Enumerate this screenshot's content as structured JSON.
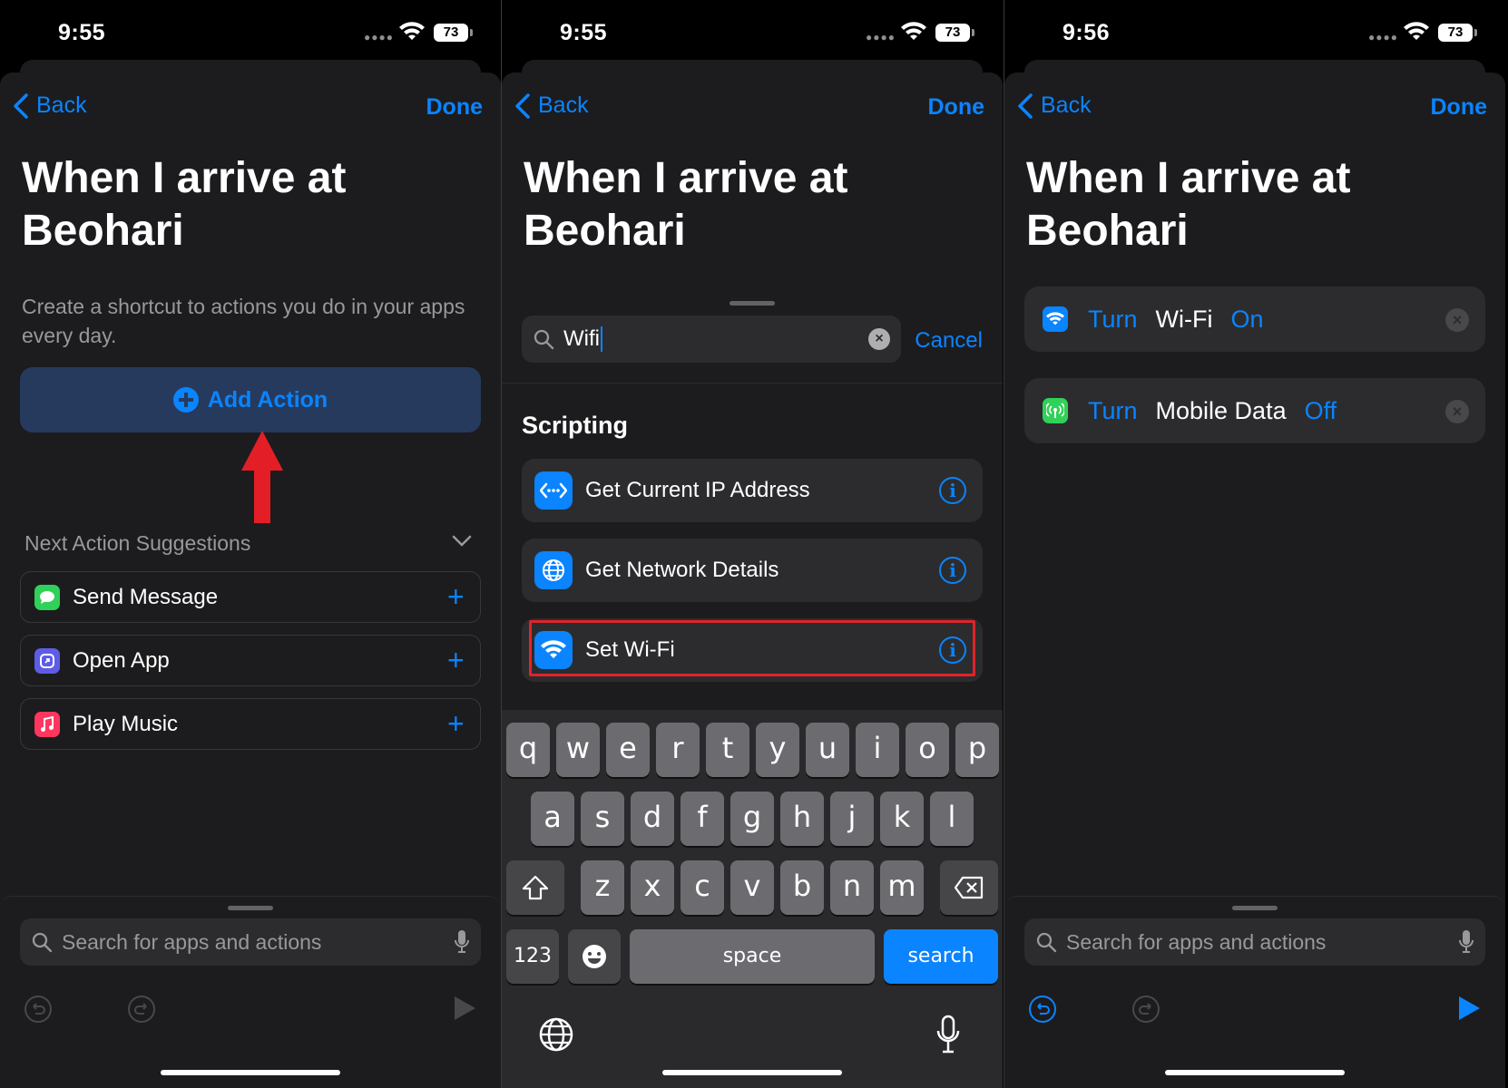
{
  "status_bars": [
    {
      "time": "9:55",
      "battery": "73"
    },
    {
      "time": "9:55",
      "battery": "73"
    },
    {
      "time": "9:56",
      "battery": "73"
    }
  ],
  "nav": {
    "back_label": "Back",
    "done_label": "Done"
  },
  "automation_title": "When I arrive at Beohari",
  "panel1": {
    "description": "Create a shortcut to actions you do in your apps every day.",
    "add_action_label": "Add Action",
    "suggestions_header": "Next Action Suggestions",
    "suggestions": [
      {
        "label": "Send Message",
        "icon": "messages-icon",
        "color": "#30d158"
      },
      {
        "label": "Open App",
        "icon": "open-app-icon",
        "color": "#5e5ce6"
      },
      {
        "label": "Play Music",
        "icon": "music-icon",
        "color": "#ff375f"
      }
    ],
    "search_placeholder": "Search for apps and actions"
  },
  "panel2": {
    "search_value": "Wifi",
    "cancel_label": "Cancel",
    "section_title": "Scripting",
    "results": [
      {
        "label": "Get Current IP Address",
        "icon": "ip-address-icon"
      },
      {
        "label": "Get Network Details",
        "icon": "globe-icon"
      },
      {
        "label": "Set Wi-Fi",
        "icon": "wifi-icon",
        "highlighted": true
      }
    ],
    "keyboard": {
      "row1": [
        "q",
        "w",
        "e",
        "r",
        "t",
        "y",
        "u",
        "i",
        "o",
        "p"
      ],
      "row2": [
        "a",
        "s",
        "d",
        "f",
        "g",
        "h",
        "j",
        "k",
        "l"
      ],
      "row3": [
        "z",
        "x",
        "c",
        "v",
        "b",
        "n",
        "m"
      ],
      "numbers_label": "123",
      "space_label": "space",
      "search_label": "search"
    }
  },
  "panel3": {
    "actions": [
      {
        "verb": "Turn",
        "target": "Wi-Fi",
        "state": "On",
        "icon": "wifi-icon",
        "color": "#0a84ff"
      },
      {
        "verb": "Turn",
        "target": "Mobile Data",
        "state": "Off",
        "icon": "cellular-icon",
        "color": "#30d158"
      }
    ],
    "search_placeholder": "Search for apps and actions"
  },
  "colors": {
    "accent": "#0a84ff",
    "highlight": "#e0242a",
    "background": "#1c1c1e"
  }
}
